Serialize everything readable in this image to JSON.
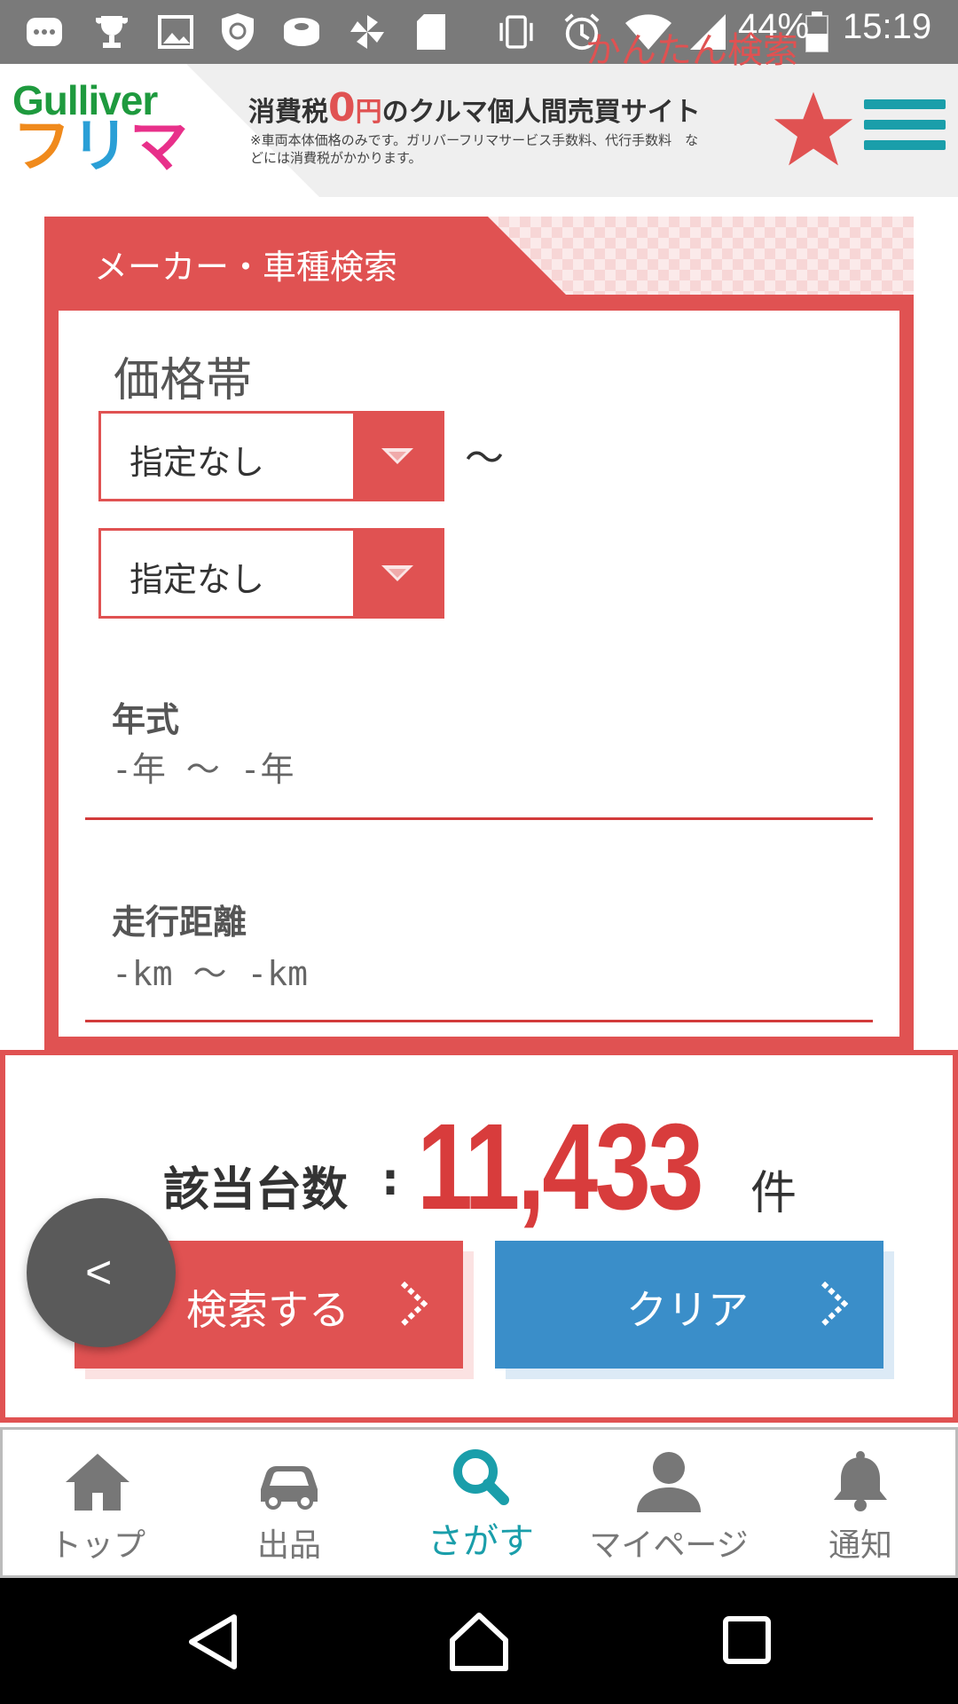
{
  "status_bar": {
    "battery": "44%",
    "time": "15:19",
    "icons": [
      "messages-icon",
      "trophy-icon",
      "image-icon",
      "shield-icon",
      "disc-icon",
      "pinwheel-icon",
      "sd-card-icon",
      "vibrate-icon",
      "alarm-icon",
      "wifi-icon",
      "signal-icon",
      "battery-icon"
    ]
  },
  "header": {
    "logo_top": "Gulliver",
    "logo_bottom": [
      "フ",
      "リ",
      "マ"
    ],
    "tagline_prefix": "消費税",
    "tagline_zero": "0",
    "tagline_yen": "円",
    "tagline_suffix": "のクルマ個人間売買サイト",
    "note": "※車両本体価格のみです。ガリバーフリマサービス手数料、代行手数料　などには消費税がかかります。",
    "favorite_icon": "star-icon",
    "menu_icon": "hamburger-menu-icon"
  },
  "tabs": {
    "active": "メーカー・車種検索",
    "inactive": "かんたん検索"
  },
  "price": {
    "label": "価格帯",
    "min_value": "指定なし",
    "max_value": "指定なし",
    "tilde": "〜"
  },
  "year": {
    "label": "年式",
    "value": "-年 〜 -年"
  },
  "mileage": {
    "label": "走行距離",
    "value": "-km 〜 -km"
  },
  "results": {
    "label": "該当台数",
    "colon": ":",
    "count": "11,433",
    "unit": "件"
  },
  "buttons": {
    "search": "検索する",
    "clear": "クリア",
    "back": "<"
  },
  "bottom_nav": [
    {
      "label": "トップ",
      "icon": "home-icon"
    },
    {
      "label": "出品",
      "icon": "car-icon"
    },
    {
      "label": "さがす",
      "icon": "search-icon"
    },
    {
      "label": "マイページ",
      "icon": "user-icon"
    },
    {
      "label": "通知",
      "icon": "bell-icon"
    }
  ],
  "colors": {
    "accent_red": "#e05252",
    "teal": "#1a9eaa",
    "clear_blue": "#3a8ec9"
  }
}
